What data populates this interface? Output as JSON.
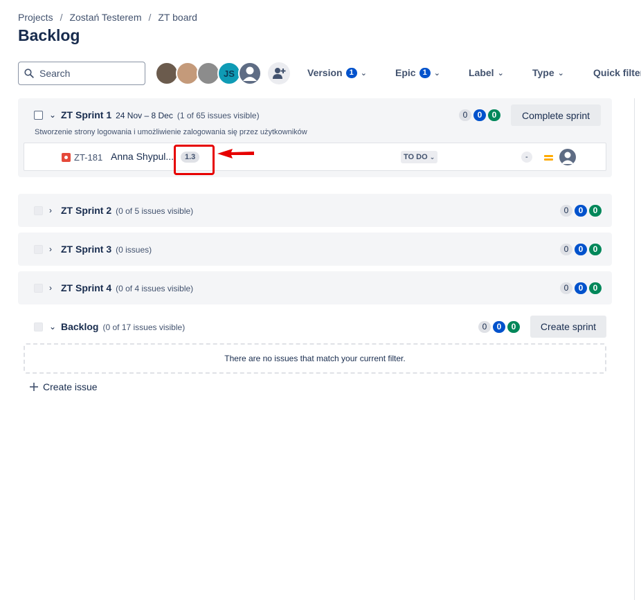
{
  "breadcrumb": [
    "Projects",
    "Zostań Testerem",
    "ZT board"
  ],
  "page_title": "Backlog",
  "search": {
    "placeholder": "Search"
  },
  "avatars": [
    {
      "initials": ""
    },
    {
      "initials": ""
    },
    {
      "initials": ""
    },
    {
      "initials": "JS"
    },
    {
      "initials": ""
    }
  ],
  "filters": [
    {
      "label": "Version",
      "count": "1"
    },
    {
      "label": "Epic",
      "count": "1"
    },
    {
      "label": "Label"
    },
    {
      "label": "Type"
    },
    {
      "label": "Quick filters"
    }
  ],
  "sprints": [
    {
      "name": "ZT Sprint 1",
      "dates": "24 Nov – 8 Dec",
      "info": "(1 of 65 issues visible)",
      "goal": "Stworzenie strony logowania i umożliwienie zalogowania się przez użytkowników",
      "counts": [
        "0",
        "0",
        "0"
      ],
      "action": "Complete sprint",
      "issues": [
        {
          "key": "ZT-181",
          "summary": "Anna Shypul...",
          "estimate": "1.3",
          "status": "TO DO",
          "epic": "-",
          "priority": "medium",
          "assignee": "unassigned"
        }
      ]
    },
    {
      "name": "ZT Sprint 2",
      "info": "(0 of 5 issues visible)",
      "counts": [
        "0",
        "0",
        "0"
      ]
    },
    {
      "name": "ZT Sprint 3",
      "info": "(0 issues)",
      "counts": [
        "0",
        "0",
        "0"
      ]
    },
    {
      "name": "ZT Sprint 4",
      "info": "(0 of 4 issues visible)",
      "counts": [
        "0",
        "0",
        "0"
      ]
    }
  ],
  "backlog": {
    "name": "Backlog",
    "info": "(0 of 17 issues visible)",
    "counts": [
      "0",
      "0",
      "0"
    ],
    "action": "Create sprint",
    "empty_message": "There are no issues that match your current filter.",
    "create_issue": "Create issue"
  },
  "colors": {
    "accent": "#0052cc",
    "done": "#00875a",
    "bug": "#e5493a",
    "priority": "#ffab00",
    "annotation": "#e60000"
  }
}
